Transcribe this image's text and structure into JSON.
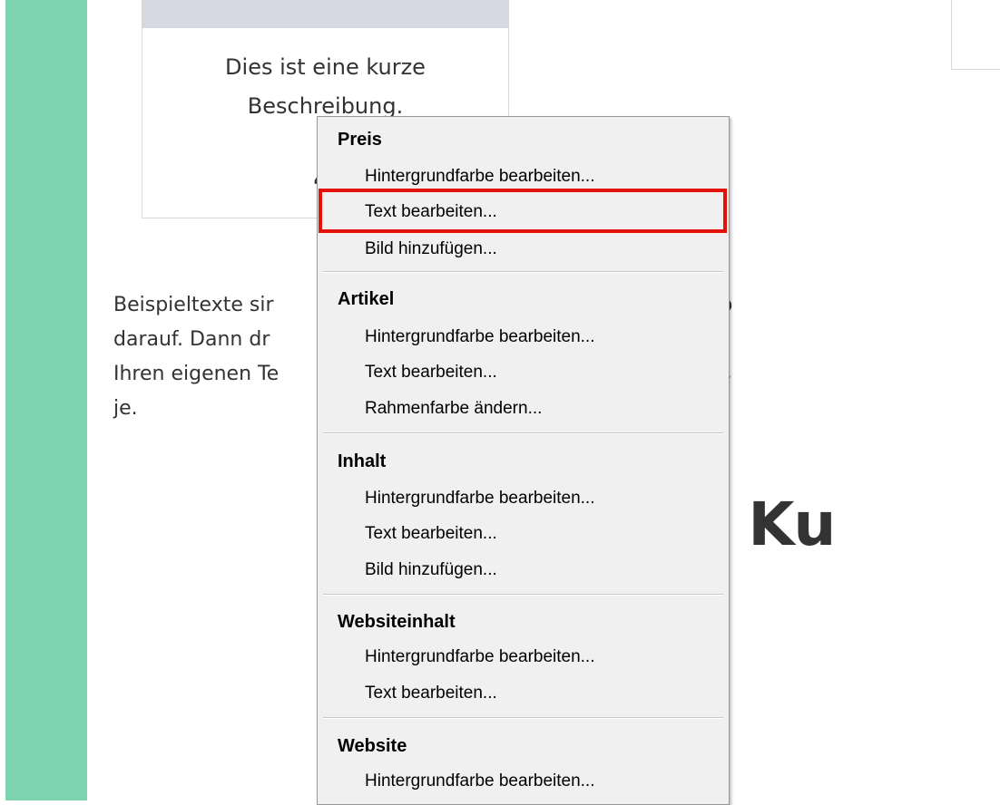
{
  "card": {
    "description_line1": "Dies ist eine kurze",
    "description_line2": "Beschreibung.",
    "price": "4,"
  },
  "paragraph": {
    "line1": "Beispieltexte sir                                      wie Ihr neuer Inhaltsb",
    "line2": "darauf. Dann dr                                       n STRG + A auf Ihrer",
    "line3": "Ihren eigenen Te                                      tsblöcke machen das",
    "line4": "je."
  },
  "heading": "sere Ku",
  "context_menu": {
    "sections": [
      {
        "title": "Preis",
        "items": [
          "Hintergrundfarbe bearbeiten...",
          "Text bearbeiten...",
          "Bild hinzufügen..."
        ]
      },
      {
        "title": "Artikel",
        "items": [
          "Hintergrundfarbe bearbeiten...",
          "Text bearbeiten...",
          "Rahmenfarbe ändern..."
        ]
      },
      {
        "title": "Inhalt",
        "items": [
          "Hintergrundfarbe bearbeiten...",
          "Text bearbeiten...",
          "Bild hinzufügen..."
        ]
      },
      {
        "title": "Websiteinhalt",
        "items": [
          "Hintergrundfarbe bearbeiten...",
          "Text bearbeiten..."
        ]
      },
      {
        "title": "Website",
        "items": [
          "Hintergrundfarbe bearbeiten..."
        ]
      }
    ]
  },
  "colors": {
    "sidebar_green": "#7dd3ad",
    "highlight_red": "#e3120b",
    "menu_bg": "#f0f0f0"
  }
}
